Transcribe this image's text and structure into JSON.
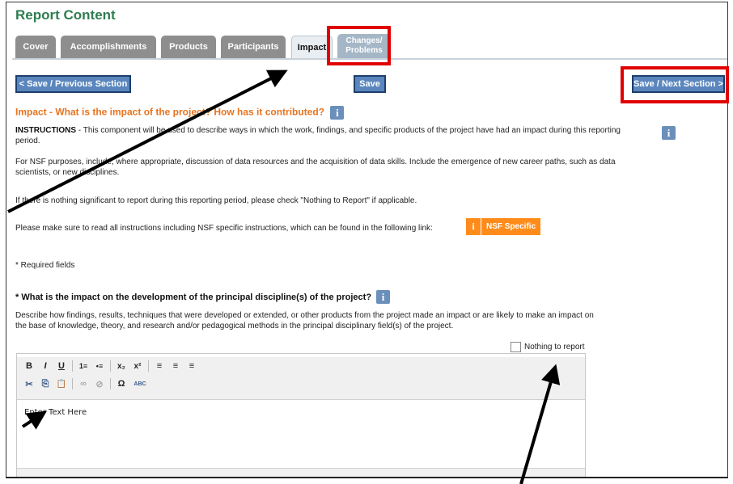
{
  "page": {
    "title": "Report Content"
  },
  "tabs": [
    {
      "label": "Cover"
    },
    {
      "label": "Accomplishments"
    },
    {
      "label": "Products"
    },
    {
      "label": "Participants"
    },
    {
      "label": "Impact"
    },
    {
      "label": "Changes/ Problems"
    }
  ],
  "toolbar_buttons": {
    "prev": "< Save / Previous Section",
    "save": "Save",
    "next": "Save / Next Section >"
  },
  "section": {
    "heading": "Impact - What is the impact of the project? How has it contributed?",
    "instructions_label": "INSTRUCTIONS",
    "instructions_text": " - This component will be used to describe ways in which the work, findings, and specific products of the project have had an impact during this reporting period.",
    "nsf_purposes": "For NSF purposes, include, where appropriate, discussion of data resources and the acquisition of data skills. Include the emergence of new career paths, such as data scientists, or new disciplines.",
    "nothing_significant": "If there is nothing significant to report during this reporting period, please check \"Nothing to Report\" if applicable.",
    "read_all": "Please make sure to read all instructions including NSF specific instructions, which can be found in the following link:",
    "nsf_specific": "NSF Specific",
    "required": "* Required fields"
  },
  "question": {
    "label": "* What is the impact on the development of the principal discipline(s) of the project?",
    "description": "Describe how findings, results, techniques that were developed or extended, or other products from the project made an impact or are likely to make an impact on the base of knowledge, theory, and research and/or pedagogical methods in the principal disciplinary field(s) of the project.",
    "nothing_to_report": "Nothing to report"
  },
  "editor": {
    "placeholder": "Enter Text Here"
  },
  "icons": {
    "info": "i",
    "bold": "B",
    "italic": "I",
    "underline": "U",
    "ordered_list": "1≡",
    "bullet_list": "•≡",
    "subscript": "x₂",
    "superscript": "x²",
    "align_left": "≡",
    "align_center": "≡",
    "align_right": "≡",
    "cut": "✂",
    "copy": "⎘",
    "paste": "📋",
    "link": "∞",
    "unlink": "⊘",
    "special_char": "Ω",
    "spellcheck": "ABC"
  },
  "colors": {
    "title_green": "#2e7d4f",
    "heading_orange": "#e8731e",
    "button_blue": "#5a86bd",
    "highlight_red": "#e00000",
    "nsf_orange": "#ff8c1a"
  }
}
